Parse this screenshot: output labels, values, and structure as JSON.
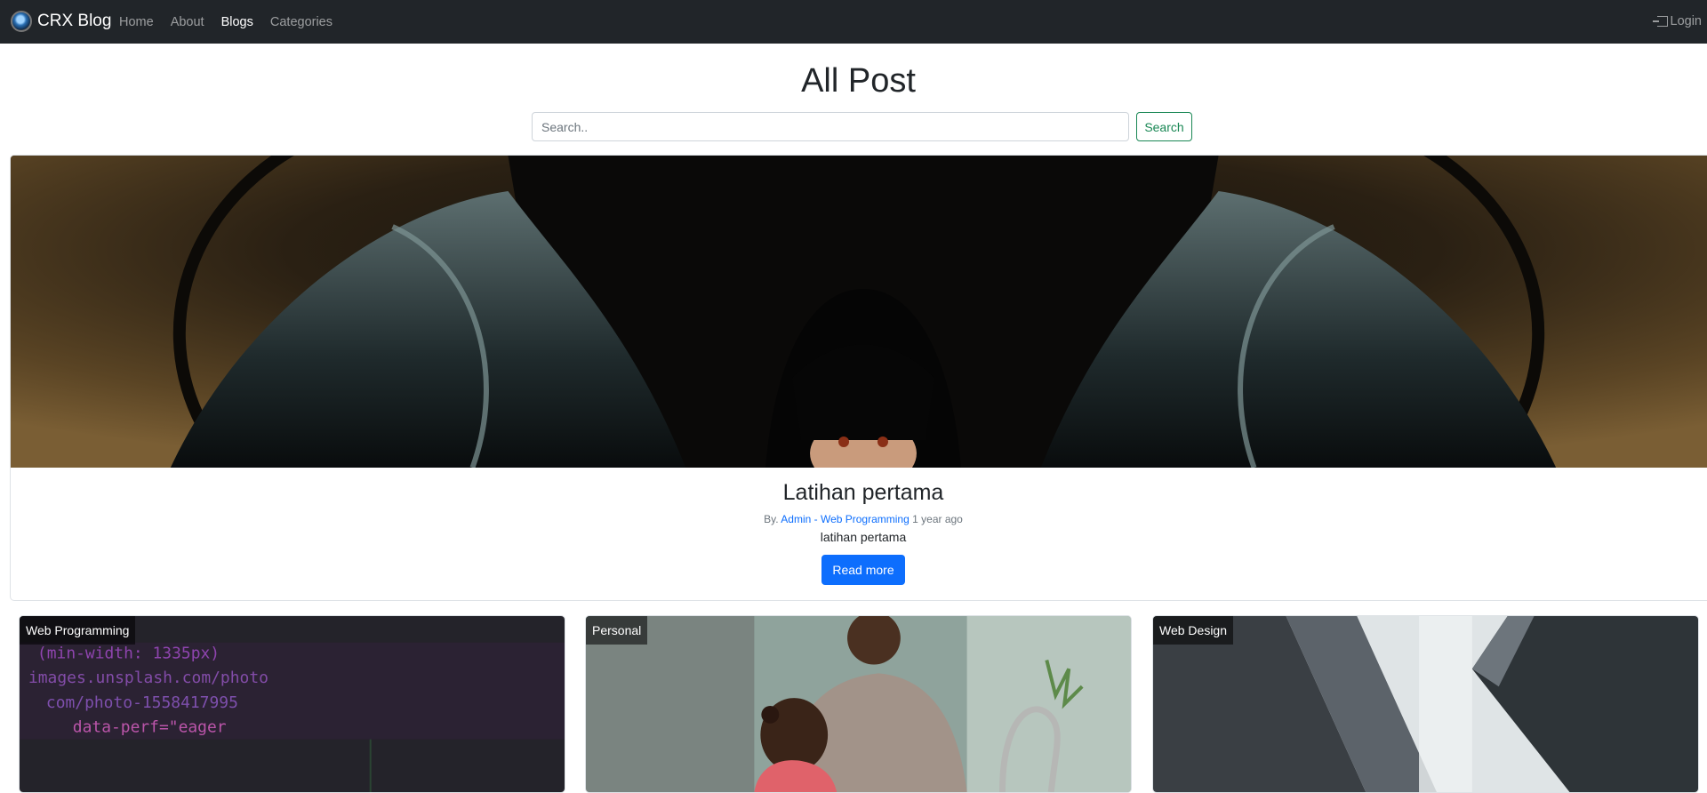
{
  "navbar": {
    "brand": "CRX Blog",
    "links": [
      {
        "label": "Home",
        "active": false
      },
      {
        "label": "About",
        "active": false
      },
      {
        "label": "Blogs",
        "active": true
      },
      {
        "label": "Categories",
        "active": false
      }
    ],
    "login": "Login"
  },
  "page": {
    "title": "All Post"
  },
  "search": {
    "placeholder": "Search..",
    "button": "Search"
  },
  "featured": {
    "title": "Latihan pertama",
    "by": "By.",
    "author": "Admin",
    "separator": "-",
    "category": "Web Programming",
    "time": "1 year ago",
    "excerpt": "latihan pertama",
    "read_more": "Read more"
  },
  "posts": [
    {
      "category": "Web Programming"
    },
    {
      "category": "Personal"
    },
    {
      "category": "Web Design"
    }
  ],
  "code_text": {
    "line1": "(min-width: 1335px)",
    "line2": "images.unsplash.com/photo",
    "line3": "com/photo-1558417995",
    "line4": "data-perf=\"eager"
  },
  "colors": {
    "navbar_bg": "#212529",
    "primary": "#0d6efd",
    "success": "#198754"
  }
}
